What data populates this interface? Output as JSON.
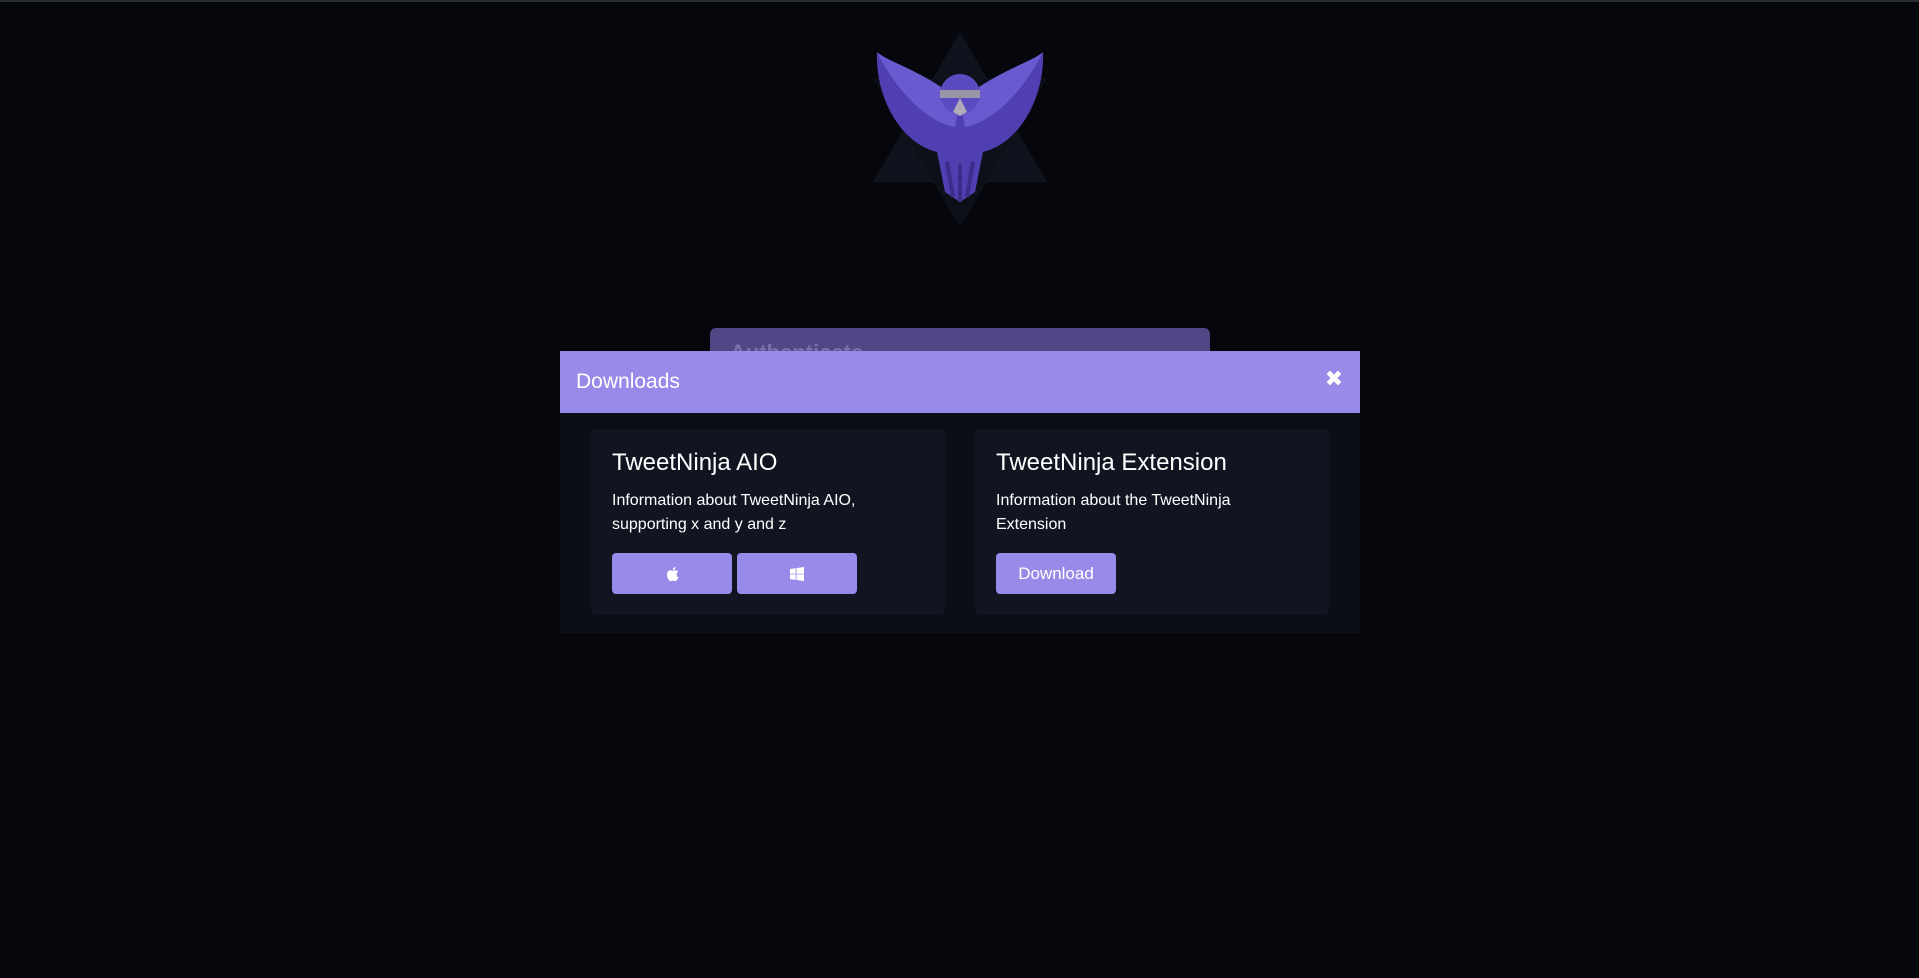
{
  "background": {
    "auth_card_title": "Authenticate"
  },
  "modal": {
    "title": "Downloads",
    "close_icon": "close-icon",
    "cards": [
      {
        "title": "TweetNinja AIO",
        "description": "Information about TweetNinja AIO, supporting x and y and z",
        "buttons": [
          {
            "icon": "apple-icon"
          },
          {
            "icon": "windows-icon"
          }
        ]
      },
      {
        "title": "TweetNinja Extension",
        "description": "Information about the TweetNinja Extension",
        "buttons": [
          {
            "label": "Download"
          }
        ]
      }
    ]
  },
  "colors": {
    "accent": "#978ae8",
    "background": "#06070c",
    "card": "#111521"
  }
}
